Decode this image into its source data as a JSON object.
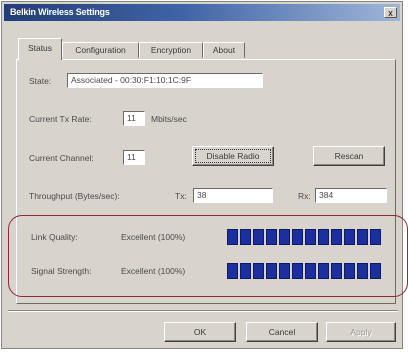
{
  "window": {
    "title": "Belkin Wireless Settings",
    "close_glyph": "x"
  },
  "tabs": [
    {
      "label": "Status"
    },
    {
      "label": "Configuration"
    },
    {
      "label": "Encryption"
    },
    {
      "label": "About"
    }
  ],
  "status": {
    "state_label": "State:",
    "state_value": "Associated - 00:30:F1:10:1C:9F",
    "tx_rate_label": "Current Tx Rate:",
    "tx_rate_value": "11",
    "tx_rate_unit": "Mbits/sec",
    "channel_label": "Current Channel:",
    "channel_value": "11",
    "disable_radio_label": "Disable Radio",
    "rescan_label": "Rescan",
    "throughput_label": "Throughput (Bytes/sec):",
    "tx_label": "Tx:",
    "tx_value": "38",
    "rx_label": "Rx:",
    "rx_value": "384"
  },
  "quality": {
    "link_label": "Link Quality:",
    "link_value": "Excellent (100%)",
    "link_level": 1.0,
    "signal_label": "Signal Strength:",
    "signal_value": "Excellent (100%)",
    "signal_level": 1.0,
    "bar_color": "#1c2fa0",
    "highlight_color": "#8a2a3a"
  },
  "footer": {
    "ok_label": "OK",
    "cancel_label": "Cancel",
    "apply_label": "Apply"
  }
}
